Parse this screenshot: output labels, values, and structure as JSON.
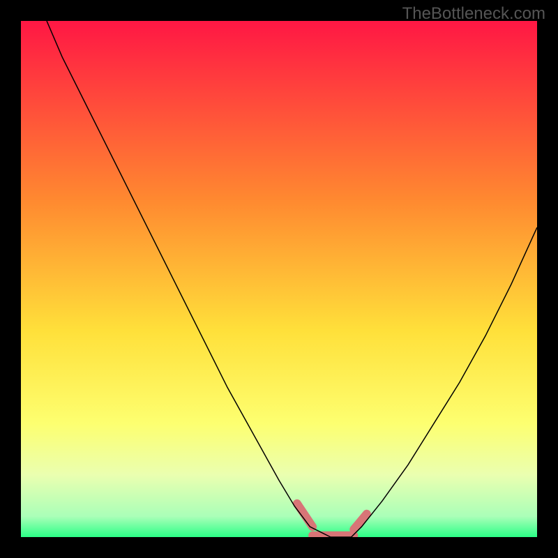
{
  "watermark": "TheBottleneck.com",
  "chart_data": {
    "type": "line",
    "title": "",
    "xlabel": "",
    "ylabel": "",
    "xlim": [
      0,
      100
    ],
    "ylim": [
      0,
      100
    ],
    "background": {
      "type": "vertical-gradient",
      "stops": [
        {
          "offset": 0,
          "color": "#ff1744"
        },
        {
          "offset": 35,
          "color": "#ff8a30"
        },
        {
          "offset": 60,
          "color": "#ffe03a"
        },
        {
          "offset": 78,
          "color": "#fdff70"
        },
        {
          "offset": 88,
          "color": "#eaffb0"
        },
        {
          "offset": 96,
          "color": "#aaffb8"
        },
        {
          "offset": 100,
          "color": "#2bff87"
        }
      ]
    },
    "series": [
      {
        "name": "bottleneck-curve",
        "stroke": "#000000",
        "stroke_width": 1.5,
        "x": [
          5,
          8,
          12,
          16,
          20,
          25,
          30,
          35,
          40,
          45,
          50,
          53,
          56,
          60,
          64,
          66,
          70,
          75,
          80,
          85,
          90,
          95,
          100
        ],
        "y": [
          100,
          93,
          85,
          77,
          69,
          59,
          49,
          39,
          29,
          20,
          11,
          6,
          2,
          0,
          0,
          2,
          7,
          14,
          22,
          30,
          39,
          49,
          60
        ]
      }
    ],
    "overlays": [
      {
        "name": "left-valley-marker",
        "type": "line",
        "stroke": "#d87577",
        "stroke_width": 12,
        "linecap": "round",
        "points": [
          [
            53.5,
            6.5
          ],
          [
            56.5,
            2.0
          ]
        ]
      },
      {
        "name": "flat-valley-marker",
        "type": "line",
        "stroke": "#d87577",
        "stroke_width": 12,
        "linecap": "round",
        "points": [
          [
            56.5,
            0.3
          ],
          [
            64.5,
            0.3
          ]
        ]
      },
      {
        "name": "right-valley-marker",
        "type": "line",
        "stroke": "#d87577",
        "stroke_width": 12,
        "linecap": "round",
        "points": [
          [
            64.5,
            1.5
          ],
          [
            67.0,
            4.5
          ]
        ]
      }
    ]
  }
}
